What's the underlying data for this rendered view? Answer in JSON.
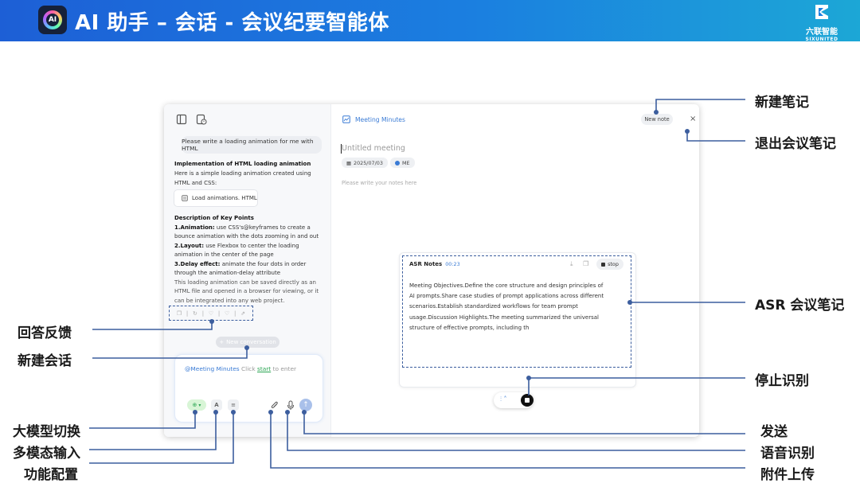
{
  "header": {
    "title": "AI 助手 – 会话 - 会议纪要智能体",
    "logo_text": "AI",
    "brand_cn": "六联智能",
    "brand_en": "SIXUNITED"
  },
  "chat": {
    "user_message": "Please write a loading animation for me with HTML",
    "reply_title": "Implementation of HTML loading animation",
    "reply_intro": "Here is a simple loading animation created using HTML and CSS:",
    "file_card": "Load animations. HTML",
    "points_title": "Description of Key Points",
    "point1_label": "1.Animation:",
    "point1_text": " use CSS's@keyframes to create a bounce animation with the dots zooming in and out",
    "point2_label": "2.Layout:",
    "point2_text": " use Flexbox to center the loading animation in the center of the page",
    "point3_label": "3.Delay effect:",
    "point3_text": " animate the four dots in order through the animation-delay attribute",
    "closing": "This loading animation can be saved directly as an HTML file and opened in a browser for viewing, or it can be integrated into any web project.",
    "new_conversation": "New conversation"
  },
  "input": {
    "mention": "@Meeting Minutes",
    "hint_before": "Click",
    "hint_link": "start",
    "hint_after": "to enter"
  },
  "notes": {
    "title": "Meeting Minutes",
    "new_note": "New note",
    "close": "×",
    "meeting_name": "Untitled meeting",
    "date": "2025/07/03",
    "owner": "ME",
    "placeholder": "Please write your notes here"
  },
  "asr": {
    "title": "ASR Notes",
    "time": "00:23",
    "stop_label": "stop",
    "body": "Meeting Objectives.Define the core structure and design principles of AI prompts.Share case studies of prompt applications across different scenarios.Establish standardized workflows for team prompt usage.Discussion Highlights.The meeting summarized the universal structure of effective prompts, including th"
  },
  "callouts": {
    "new_note": "新建笔记",
    "exit_note": "退出会议笔记",
    "asr_note": "ASR 会议笔记",
    "stop_recognition": "停止识别",
    "send": "发送",
    "voice_recognition": "语音识别",
    "attachment": "附件上传",
    "feedback": "回答反馈",
    "new_conversation": "新建会话",
    "model_switch": "大模型切换",
    "multimodal_input": "多模态输入",
    "function_config": "功能配置"
  },
  "icons": {
    "sidebar_toggle": "panel-icon",
    "history": "history-icon",
    "copy": "copy-icon",
    "regenerate": "refresh-icon",
    "like": "thumb-up-icon",
    "dislike": "thumb-down-icon",
    "share": "share-icon",
    "attachment": "paperclip-icon",
    "mic": "mic-icon",
    "send": "arrow-up-icon",
    "calendar": "calendar-icon",
    "download": "download-icon"
  },
  "colors": {
    "accent": "#3a7bd5",
    "header_start": "#1d5fd6",
    "header_end": "#1ca7d6",
    "callout_line": "#3c5e9e",
    "model_badge": "#2aa552"
  }
}
